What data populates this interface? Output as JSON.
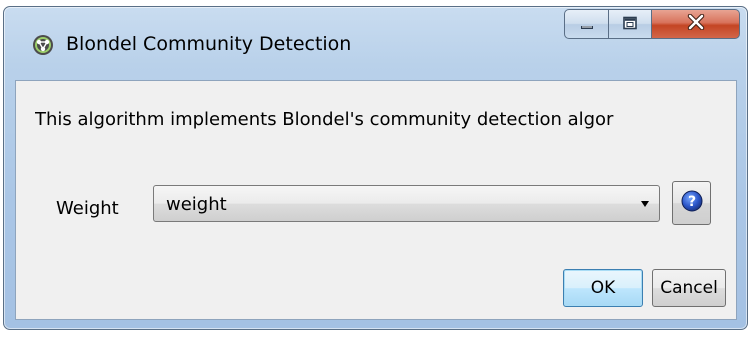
{
  "window": {
    "title": "Blondel Community Detection",
    "app_icon": "gephi-logo-icon",
    "controls": {
      "minimize_icon": "minimize-icon",
      "maximize_icon": "maximize-icon",
      "close_icon": "close-icon"
    }
  },
  "dialog": {
    "description": "This algorithm implements Blondel's community detection algor",
    "weight": {
      "label": "Weight",
      "selected_value": "weight"
    },
    "help_icon": "help-icon",
    "buttons": {
      "ok_label": "OK",
      "cancel_label": "Cancel"
    }
  },
  "colors": {
    "frame": "#b9d1ea",
    "content_bg": "#f0f0f0",
    "close_red": "#c44524",
    "ok_border": "#3c7fb1"
  }
}
